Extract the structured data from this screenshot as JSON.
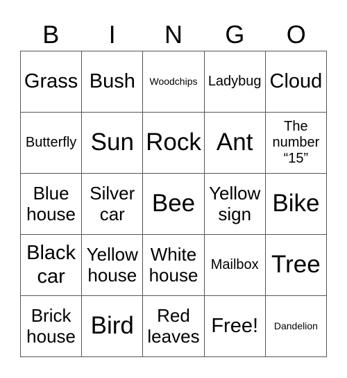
{
  "header": [
    "B",
    "I",
    "N",
    "G",
    "O"
  ],
  "cells": [
    {
      "text": "Grass",
      "size": "l"
    },
    {
      "text": "Bush",
      "size": "l"
    },
    {
      "text": "Woodchips",
      "size": "xxs"
    },
    {
      "text": "Ladybug",
      "size": "s"
    },
    {
      "text": "Cloud",
      "size": "l"
    },
    {
      "text": "Butterfly",
      "size": "s"
    },
    {
      "text": "Sun",
      "size": "xl"
    },
    {
      "text": "Rock",
      "size": "xl"
    },
    {
      "text": "Ant",
      "size": "xl"
    },
    {
      "text": "The number “15”",
      "size": "s"
    },
    {
      "text": "Blue house",
      "size": "m"
    },
    {
      "text": "Silver car",
      "size": "m"
    },
    {
      "text": "Bee",
      "size": "xl"
    },
    {
      "text": "Yellow sign",
      "size": "m"
    },
    {
      "text": "Bike",
      "size": "xl"
    },
    {
      "text": "Black car",
      "size": "l"
    },
    {
      "text": "Yellow house",
      "size": "m"
    },
    {
      "text": "White house",
      "size": "m"
    },
    {
      "text": "Mailbox",
      "size": "s"
    },
    {
      "text": "Tree",
      "size": "xl"
    },
    {
      "text": "Brick house",
      "size": "m"
    },
    {
      "text": "Bird",
      "size": "xl"
    },
    {
      "text": "Red leaves",
      "size": "m"
    },
    {
      "text": "Free!",
      "size": "l"
    },
    {
      "text": "Dandelion",
      "size": "xxs"
    }
  ]
}
